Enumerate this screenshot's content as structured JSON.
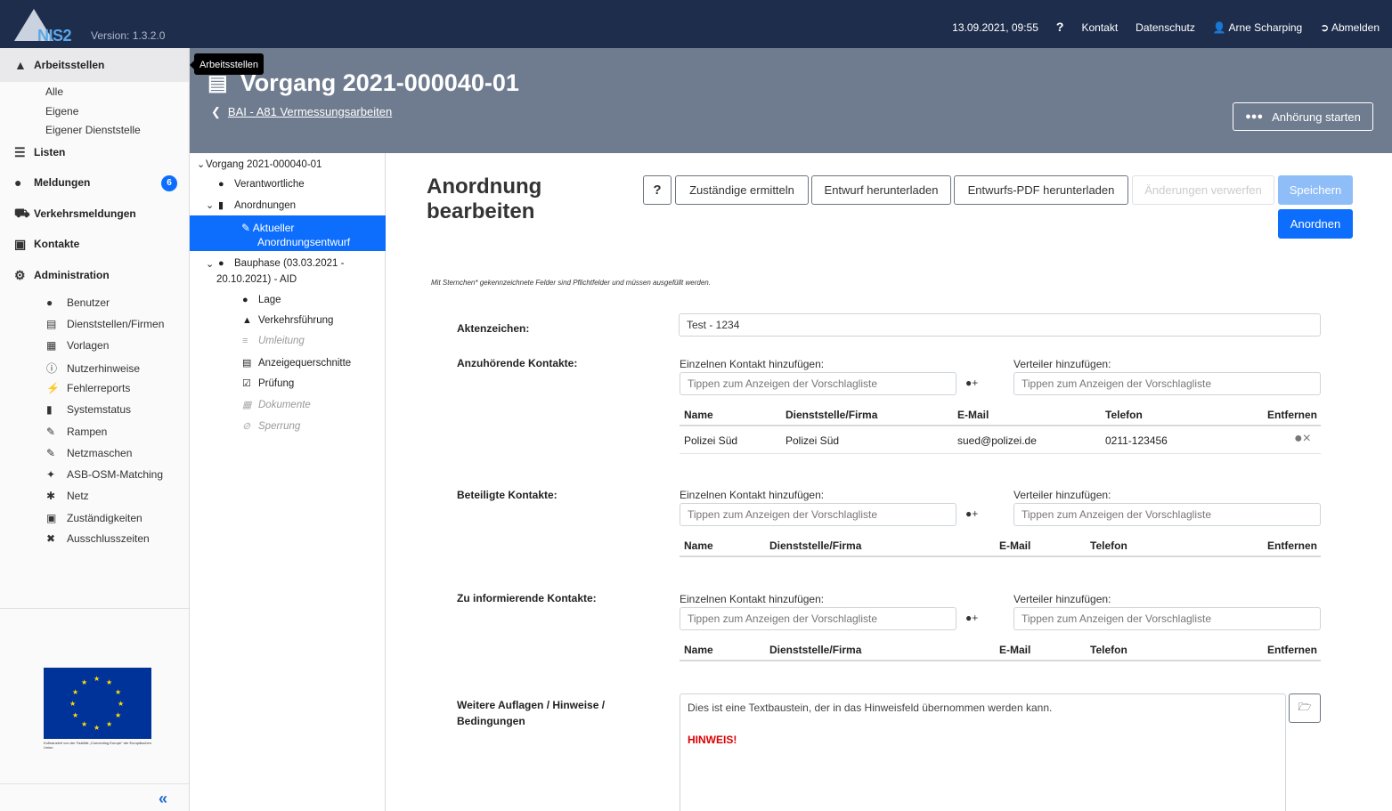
{
  "topbar": {
    "logo_text": "NIS2",
    "version": "Version: 1.3.2.0",
    "datetime": "13.09.2021, 09:55",
    "help": "?",
    "contact": "Kontakt",
    "privacy": "Datenschutz",
    "user": "Arne Scharping",
    "logout": "Abmelden"
  },
  "sidebar": {
    "arbeitsstellen": "Arbeitsstellen",
    "arbeitsstellen_items": [
      "Alle",
      "Eigene",
      "Eigener Dienststelle"
    ],
    "listen": "Listen",
    "meldungen": "Meldungen",
    "meldungen_badge": "6",
    "verkehrsmeldungen": "Verkehrsmeldungen",
    "kontakte": "Kontakte",
    "administration": "Administration",
    "admin_items": [
      "Benutzer",
      "Dienststellen/Firmen",
      "Vorlagen",
      "Nutzerhinweise",
      "Fehlerreports",
      "Systemstatus",
      "Rampen",
      "Netzmaschen",
      "ASB-OSM-Matching",
      "Netz",
      "Zuständigkeiten",
      "Ausschlusszeiten"
    ],
    "eu_caption": "Kofinanziert von der Fazilität „Connecting Europe“ der Europäischen Union",
    "collapse": "«"
  },
  "tooltip": "Arbeitsstellen",
  "header": {
    "title": "Vorgang 2021-000040-01",
    "back_link": "BAI - A81 Vermessungsarbeiten",
    "hearing_button": "Anhörung starten"
  },
  "tree": {
    "root": "Vorgang 2021-000040-01",
    "verantwortliche": "Verantwortliche",
    "anordnungen": "Anordnungen",
    "selected_line1": "Aktueller",
    "selected_line2": "Anordnungsentwurf",
    "bauphase_line1": "Bauphase (03.03.2021 -",
    "bauphase_line2": "20.10.2021) - AID",
    "lage": "Lage",
    "verkehrsfuehrung": "Verkehrsführung",
    "umleitung": "Umleitung",
    "anzeigequerschnitte": "Anzeigequerschnitte",
    "pruefung": "Prüfung",
    "dokumente": "Dokumente",
    "sperrung": "Sperrung"
  },
  "content": {
    "title": "Anordnung bearbeiten",
    "buttons": {
      "help": "?",
      "zustaendige": "Zuständige ermitteln",
      "entwurf": "Entwurf herunterladen",
      "entwurf_pdf": "Entwurfs-PDF herunterladen",
      "verwerfen": "Änderungen verwerfen",
      "speichern": "Speichern",
      "anordnen": "Anordnen"
    },
    "note": "Mit Sternchen* gekennzeichnete Felder sind Pflichtfelder und müssen ausgefüllt werden.",
    "aktenzeichen_label": "Aktenzeichen:",
    "aktenzeichen_value": "Test - 1234",
    "single_contact_label": "Einzelnen Kontakt hinzufügen:",
    "distributor_label": "Verteiler hinzufügen:",
    "placeholder": "Tippen zum Anzeigen der Vorschlagliste",
    "columns": [
      "Name",
      "Dienststelle/Firma",
      "E-Mail",
      "Telefon",
      "Entfernen"
    ],
    "anzuhoerende_label": "Anzuhörende Kontakte:",
    "anzuhoerende_rows": [
      {
        "name": "Polizei Süd",
        "org": "Polizei Süd",
        "email": "sued@polizei.de",
        "phone": "0211-123456"
      }
    ],
    "beteiligte_label": "Beteiligte Kontakte:",
    "informierende_label": "Zu informierende Kontakte:",
    "auflagen_label_1": "Weitere Auflagen / Hinweise /",
    "auflagen_label_2": "Bedingungen",
    "auflagen_text": "Dies ist eine Textbaustein, der in das Hinweisfeld übernommen werden kann.",
    "auflagen_hint": "HINWEIS!"
  },
  "colors": {
    "topbar": "#1f2d4d",
    "header": "#6f7c8f",
    "primary": "#0d6efd",
    "hint_red": "#dd0000"
  }
}
